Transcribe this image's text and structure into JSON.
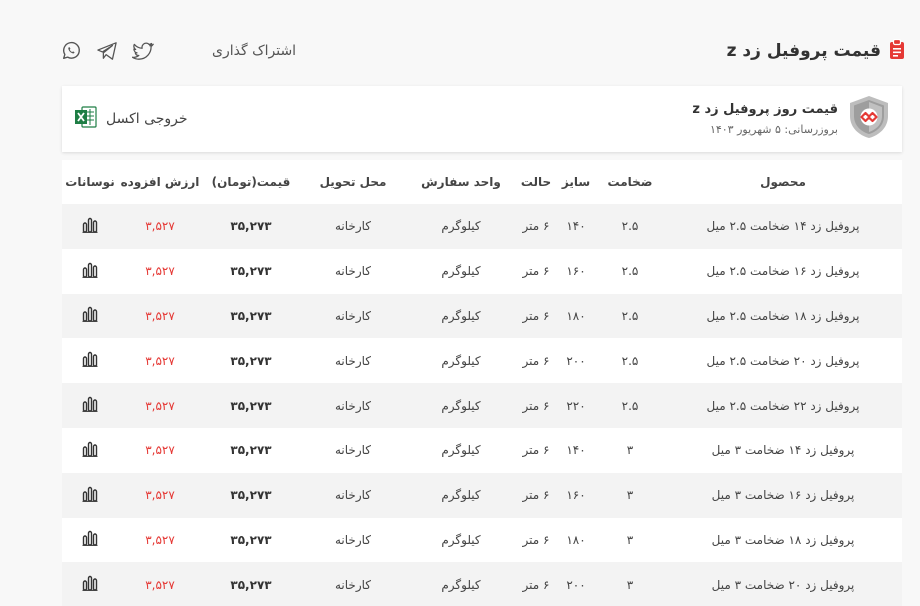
{
  "header": {
    "title": "قیمت پروفیل زد z",
    "share_label": "اشتراک گذاری",
    "share_icons": [
      "linkedin-icon",
      "twitter-icon",
      "telegram-icon",
      "whatsapp-icon"
    ]
  },
  "card": {
    "heading": "قیمت روز پروفیل زد z",
    "updated": "بروزرسانی: ۵ شهریور ۱۴۰۳",
    "excel_label": "خروجی اکسل"
  },
  "colors": {
    "accent": "#e53935",
    "excel": "#1e7e45"
  },
  "table": {
    "headers": [
      "محصول",
      "ضخامت",
      "سایز",
      "حالت",
      "واحد سفارش",
      "محل تحویل",
      "قیمت(تومان)",
      "ارزش افزوده",
      "نوسانات"
    ],
    "rows": [
      {
        "product": "پروفیل زد ۱۴ ضخامت ۲.۵ میل",
        "thickness": "۲.۵",
        "size": "۱۴۰",
        "state": "۶ متر",
        "unit": "کیلوگرم",
        "place": "کارخانه",
        "price": "۳۵,۲۷۳",
        "vat": "۳,۵۲۷"
      },
      {
        "product": "پروفیل زد ۱۶ ضخامت ۲.۵ میل",
        "thickness": "۲.۵",
        "size": "۱۶۰",
        "state": "۶ متر",
        "unit": "کیلوگرم",
        "place": "کارخانه",
        "price": "۳۵,۲۷۳",
        "vat": "۳,۵۲۷"
      },
      {
        "product": "پروفیل زد ۱۸ ضخامت ۲.۵ میل",
        "thickness": "۲.۵",
        "size": "۱۸۰",
        "state": "۶ متر",
        "unit": "کیلوگرم",
        "place": "کارخانه",
        "price": "۳۵,۲۷۳",
        "vat": "۳,۵۲۷"
      },
      {
        "product": "پروفیل زد ۲۰ ضخامت ۲.۵ میل",
        "thickness": "۲.۵",
        "size": "۲۰۰",
        "state": "۶ متر",
        "unit": "کیلوگرم",
        "place": "کارخانه",
        "price": "۳۵,۲۷۳",
        "vat": "۳,۵۲۷"
      },
      {
        "product": "پروفیل زد ۲۲ ضخامت ۲.۵ میل",
        "thickness": "۲.۵",
        "size": "۲۲۰",
        "state": "۶ متر",
        "unit": "کیلوگرم",
        "place": "کارخانه",
        "price": "۳۵,۲۷۳",
        "vat": "۳,۵۲۷"
      },
      {
        "product": "پروفیل زد ۱۴ ضخامت ۳ میل",
        "thickness": "۳",
        "size": "۱۴۰",
        "state": "۶ متر",
        "unit": "کیلوگرم",
        "place": "کارخانه",
        "price": "۳۵,۲۷۳",
        "vat": "۳,۵۲۷"
      },
      {
        "product": "پروفیل زد ۱۶ ضخامت ۳ میل",
        "thickness": "۳",
        "size": "۱۶۰",
        "state": "۶ متر",
        "unit": "کیلوگرم",
        "place": "کارخانه",
        "price": "۳۵,۲۷۳",
        "vat": "۳,۵۲۷"
      },
      {
        "product": "پروفیل زد ۱۸ ضخامت ۳ میل",
        "thickness": "۳",
        "size": "۱۸۰",
        "state": "۶ متر",
        "unit": "کیلوگرم",
        "place": "کارخانه",
        "price": "۳۵,۲۷۳",
        "vat": "۳,۵۲۷"
      },
      {
        "product": "پروفیل زد ۲۰ ضخامت ۳ میل",
        "thickness": "۳",
        "size": "۲۰۰",
        "state": "۶ متر",
        "unit": "کیلوگرم",
        "place": "کارخانه",
        "price": "۳۵,۲۷۳",
        "vat": "۳,۵۲۷"
      }
    ]
  }
}
